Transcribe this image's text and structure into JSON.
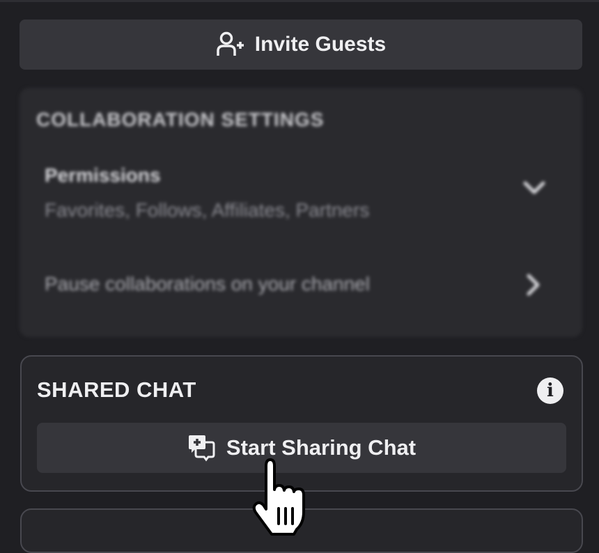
{
  "invite": {
    "label": "Invite Guests",
    "icon": "add-person-icon"
  },
  "collaboration_settings": {
    "title": "COLLABORATION SETTINGS",
    "permissions": {
      "label": "Permissions",
      "value": "Favorites, Follows, Affiliates, Partners",
      "icon": "chevron-down-icon"
    },
    "pause": {
      "label": "Pause collaborations on your channel",
      "icon": "chevron-right-icon"
    }
  },
  "shared_chat": {
    "title": "SHARED CHAT",
    "info_icon": "i",
    "button_label": "Start Sharing Chat",
    "button_icon": "chat-share-icon"
  },
  "cursor": {
    "icon": "hand-pointer-icon"
  },
  "colors": {
    "background": "#1f1f23",
    "button": "#36363b",
    "card_border": "#48484f",
    "text": "#efeff1"
  }
}
